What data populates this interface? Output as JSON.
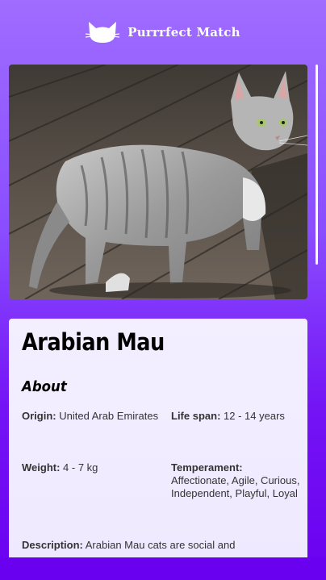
{
  "app": {
    "name": "Purrrfect Match"
  },
  "cat": {
    "breed": "Arabian Mau",
    "about_heading": "About",
    "origin_label": "Origin:",
    "origin_value": "United Arab Emirates",
    "lifespan_label": "Life span:",
    "lifespan_value": "12 - 14 years",
    "weight_label": "Weight:",
    "weight_value": "4 - 7 kg",
    "temperament_label": "Temperament:",
    "temperament_value": "Affectionate, Agile, Curious, Independent, Playful, Loyal",
    "description_label": "Description:",
    "description_value": "Arabian Mau cats are social and"
  },
  "colors": {
    "brand_top": "#9f6cff",
    "brand_bottom": "#6a00f0",
    "card": "#f1ecff"
  },
  "icons": {
    "logo": "cat-head-icon"
  }
}
